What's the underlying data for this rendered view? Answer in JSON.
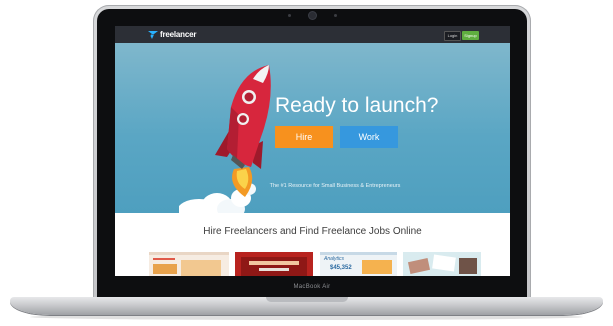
{
  "laptop": {
    "model": "MacBook Air"
  },
  "site": {
    "logo_text": "freelancer",
    "nav": {
      "login": "Login",
      "signup": "Signup"
    },
    "hero": {
      "title": "Ready to launch?",
      "hire_label": "Hire",
      "work_label": "Work",
      "tagline": "The #1 Resource for Small Business & Entrepreneurs"
    },
    "section": {
      "title": "Hire Freelancers and Find Freelance Jobs Online",
      "thumb3_heading": "Analytics",
      "thumb3_value": "$45,352"
    }
  },
  "colors": {
    "topbar": "#2c2f36",
    "hero_sky": "#5aa6c4",
    "hire": "#f7911e",
    "work": "#3698de",
    "signup": "#5fae3f",
    "rocket": "#d7263d"
  }
}
